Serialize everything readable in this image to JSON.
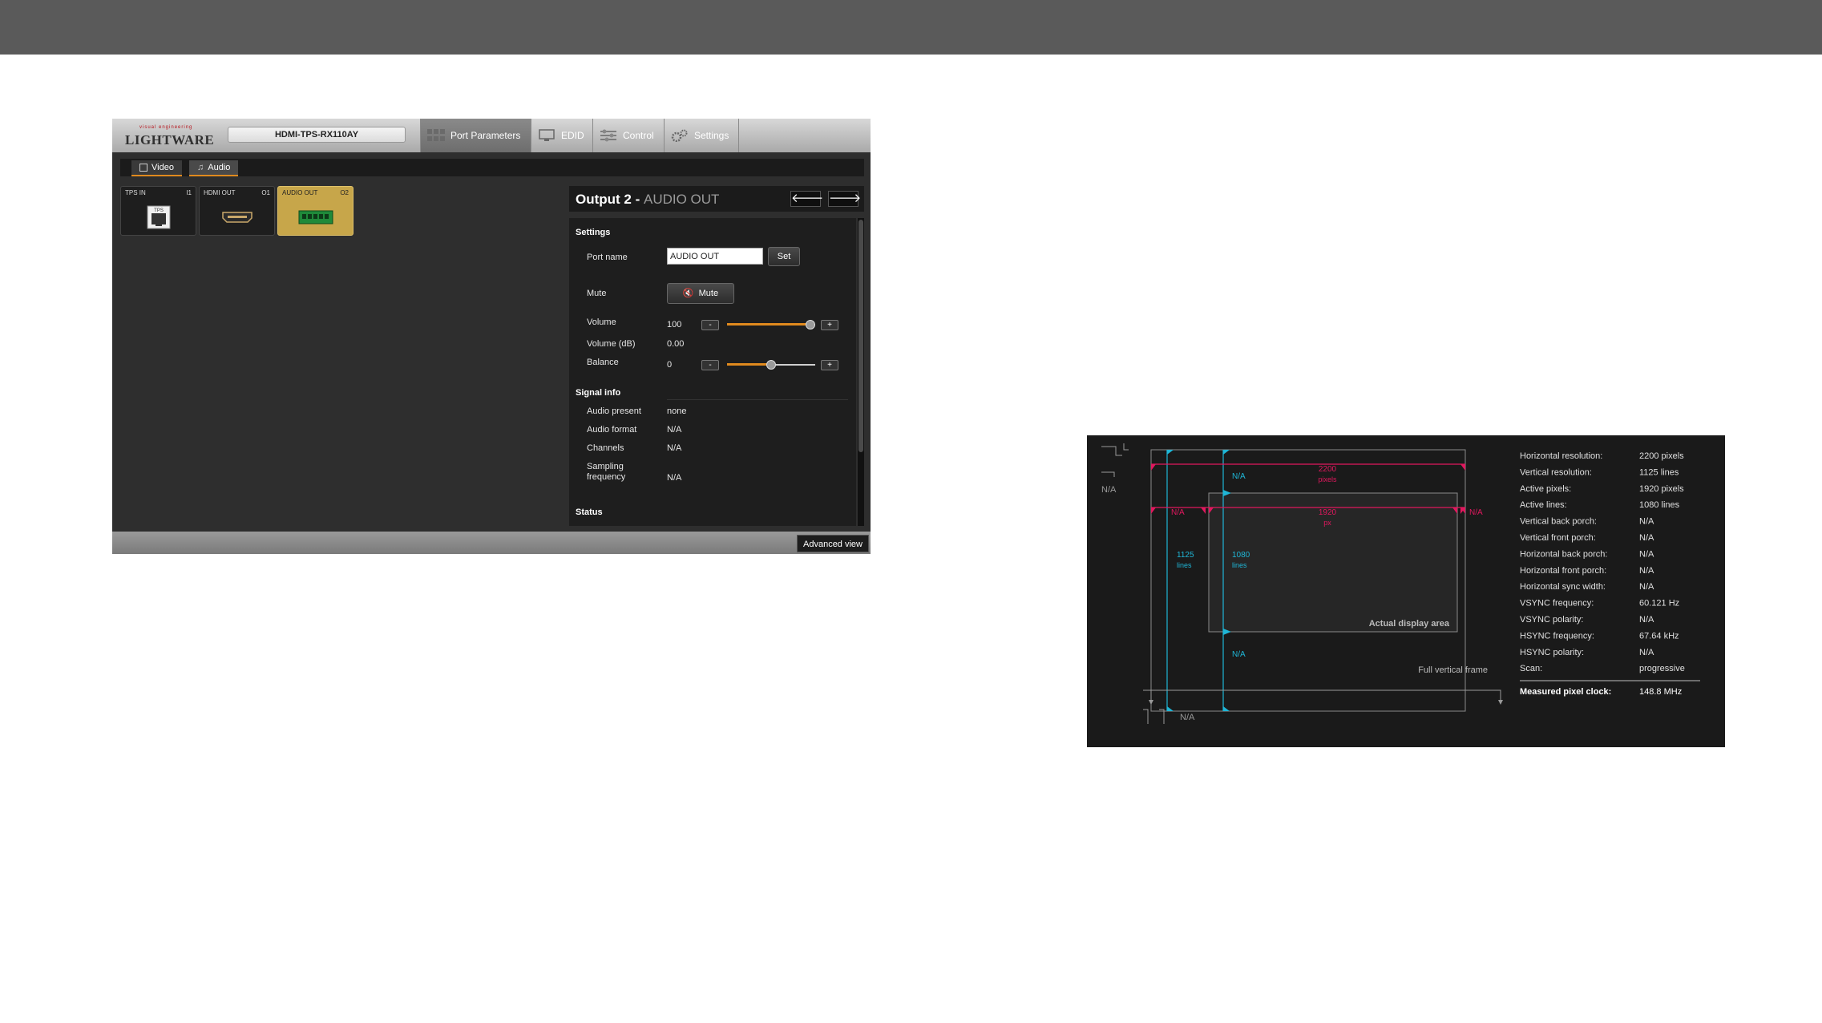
{
  "app": {
    "logo_tag": "visual engineering",
    "logo_name": "LIGHTWARE",
    "device_name": "HDMI-TPS-RX110AY",
    "nav_tabs": [
      {
        "label": "Port Parameters"
      },
      {
        "label": "EDID"
      },
      {
        "label": "Control"
      },
      {
        "label": "Settings"
      }
    ],
    "sub_tabs": [
      {
        "label": "Video"
      },
      {
        "label": "Audio"
      }
    ],
    "ports": [
      {
        "label": "TPS IN",
        "num": "I1",
        "connector": "TPS"
      },
      {
        "label": "HDMI OUT",
        "num": "O1",
        "connector": "HDMI"
      },
      {
        "label": "AUDIO OUT",
        "num": "O2",
        "connector": "AUDIO"
      }
    ],
    "panel": {
      "title_main": "Output 2 -",
      "title_sub": "AUDIO OUT",
      "prev_arrow": "🡐",
      "next_arrow": "🡒",
      "settings_heading": "Settings",
      "port_name_label": "Port name",
      "port_name_value": "AUDIO OUT",
      "set_button": "Set",
      "mute_label": "Mute",
      "mute_button": "Mute",
      "volume_label": "Volume",
      "volume_value": "100",
      "volume_level": 1.0,
      "volume_db_label": "Volume (dB)",
      "volume_db_value": "0.00",
      "balance_label": "Balance",
      "balance_value": "0",
      "balance_level": 0.5,
      "minus": "-",
      "plus": "+",
      "signal_heading": "Signal info",
      "signal_rows": [
        {
          "label": "Audio present",
          "value": "none"
        },
        {
          "label": "Audio format",
          "value": "N/A"
        },
        {
          "label": "Channels",
          "value": "N/A"
        },
        {
          "label": "Sampling frequency",
          "value": "N/A"
        }
      ],
      "status_heading": "Status"
    },
    "advanced_view": "Advanced view"
  },
  "timing": {
    "top_left_na": "N/A",
    "hsync_na": "N/A",
    "hfront_na": "N/A",
    "total_pixels": "2200",
    "total_pixels_unit": "pixels",
    "active_pixels": "1920",
    "active_pixels_unit": "px",
    "hback_na": "N/A",
    "right_na": "N/A",
    "total_lines": "1125",
    "total_lines_unit": "lines",
    "active_lines": "1080",
    "active_lines_unit": "lines",
    "vback_na": "N/A",
    "bottom_na": "N/A",
    "actual_display_area": "Actual display area",
    "full_vertical_frame": "Full vertical frame",
    "info": [
      {
        "label": "Horizontal resolution:",
        "value": "2200 pixels"
      },
      {
        "label": "Vertical resolution:",
        "value": "1125 lines"
      },
      {
        "label": "Active pixels:",
        "value": "1920 pixels"
      },
      {
        "label": "Active lines:",
        "value": "1080 lines"
      },
      {
        "label": "Vertical back porch:",
        "value": "N/A"
      },
      {
        "label": "Vertical front porch:",
        "value": "N/A"
      },
      {
        "label": "Horizontal back porch:",
        "value": "N/A"
      },
      {
        "label": "Horizontal front porch:",
        "value": "N/A"
      },
      {
        "label": "Horizontal sync width:",
        "value": "N/A"
      },
      {
        "label": "VSYNC frequency:",
        "value": "60.121 Hz"
      },
      {
        "label": "VSYNC polarity:",
        "value": "N/A"
      },
      {
        "label": "HSYNC frequency:",
        "value": "67.64 kHz"
      },
      {
        "label": "HSYNC polarity:",
        "value": "N/A"
      },
      {
        "label": "Scan:",
        "value": "progressive"
      }
    ],
    "pixel_clock_label": "Measured pixel clock:",
    "pixel_clock_value": "148.8 MHz",
    "colors": {
      "cyan": "#1fb6d6",
      "magenta": "#e0185e"
    }
  }
}
